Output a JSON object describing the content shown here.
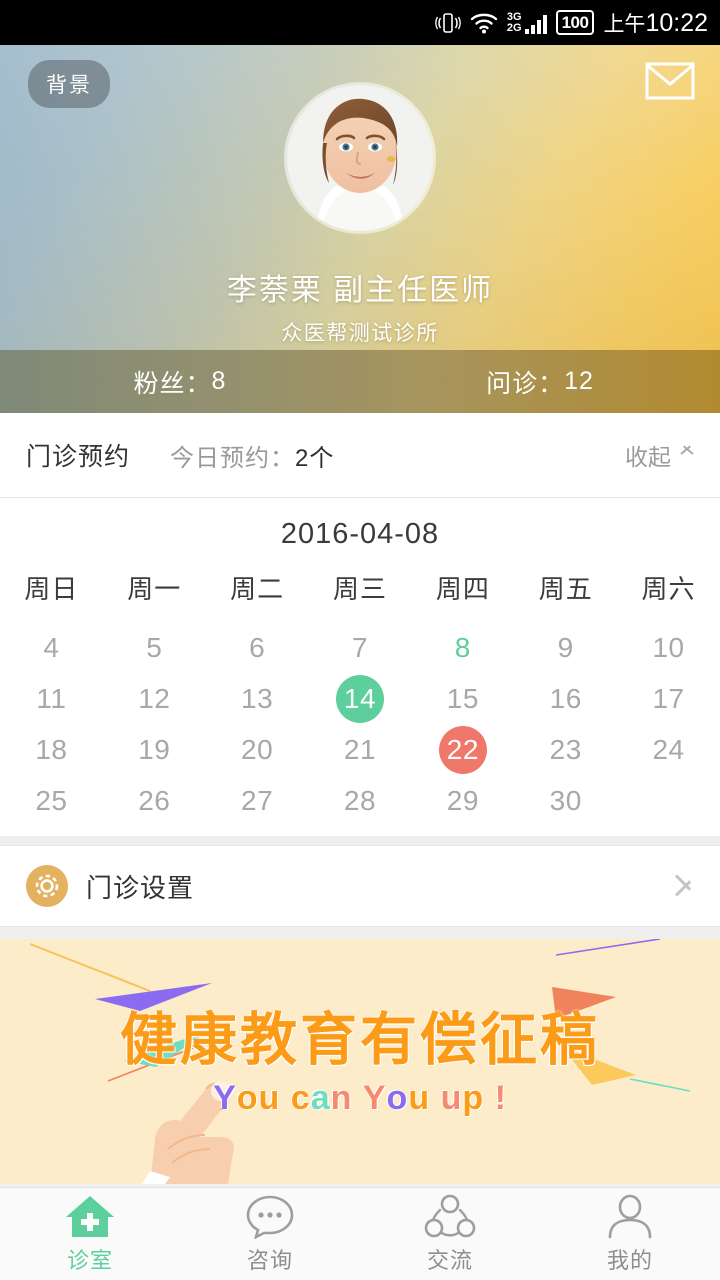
{
  "statusbar": {
    "vibrate_icon": "vibrate-icon",
    "wifi_icon": "wifi-icon",
    "signal_3g": "3G",
    "signal_2g": "2G",
    "battery": "100",
    "ampm": "上午",
    "time": "10:22"
  },
  "header": {
    "background_button": "背景",
    "mail_icon": "envelope-icon",
    "avatar_alt": "doctor-avatar",
    "doctor_name": "李萘栗 副主任医师",
    "clinic_name": "众医帮测试诊所",
    "gradient_from": "#9bb7c9",
    "gradient_to": "#f9cb57"
  },
  "stats": [
    {
      "label": "粉丝：",
      "value": "8"
    },
    {
      "label": "问诊：",
      "value": "12"
    }
  ],
  "appointments": {
    "title": "门诊预约",
    "today_label": "今日预约：",
    "today_count": "2个",
    "toggle_label": "收起"
  },
  "calendar": {
    "date": "2016-04-08",
    "weekdays": [
      "周日",
      "周一",
      "周二",
      "周三",
      "周四",
      "周五",
      "周六"
    ],
    "today_color": "#5dcf9d",
    "marked_green_color": "#5dcf9d",
    "marked_red_color": "#f0786a",
    "cells": [
      {
        "day": "4",
        "state": "normal"
      },
      {
        "day": "5",
        "state": "normal"
      },
      {
        "day": "6",
        "state": "normal"
      },
      {
        "day": "7",
        "state": "normal"
      },
      {
        "day": "8",
        "state": "today"
      },
      {
        "day": "9",
        "state": "normal"
      },
      {
        "day": "10",
        "state": "normal"
      },
      {
        "day": "11",
        "state": "normal"
      },
      {
        "day": "12",
        "state": "normal"
      },
      {
        "day": "13",
        "state": "normal"
      },
      {
        "day": "14",
        "state": "green"
      },
      {
        "day": "15",
        "state": "normal"
      },
      {
        "day": "16",
        "state": "normal"
      },
      {
        "day": "17",
        "state": "normal"
      },
      {
        "day": "18",
        "state": "normal"
      },
      {
        "day": "19",
        "state": "normal"
      },
      {
        "day": "20",
        "state": "normal"
      },
      {
        "day": "21",
        "state": "normal"
      },
      {
        "day": "22",
        "state": "red"
      },
      {
        "day": "23",
        "state": "normal"
      },
      {
        "day": "24",
        "state": "normal"
      },
      {
        "day": "25",
        "state": "normal"
      },
      {
        "day": "26",
        "state": "normal"
      },
      {
        "day": "27",
        "state": "normal"
      },
      {
        "day": "28",
        "state": "normal"
      },
      {
        "day": "29",
        "state": "normal"
      },
      {
        "day": "30",
        "state": "normal"
      },
      {
        "day": "",
        "state": "empty"
      }
    ]
  },
  "settings_row": {
    "icon": "gear-icon",
    "label": "门诊设置",
    "chevron": "chevron-right-icon",
    "icon_color": "#e3b261"
  },
  "banner": {
    "title": "健康教育有偿征稿",
    "title_color": "#fb9b18",
    "background": "#fcecc9",
    "subtitle_letters": [
      {
        "char": "Y",
        "color": "#8b6cf0"
      },
      {
        "char": "o",
        "color": "#fb9b18"
      },
      {
        "char": "u",
        "color": "#fb9b18"
      },
      {
        "char": " ",
        "color": "#fb9b18"
      },
      {
        "char": "c",
        "color": "#fb9b18"
      },
      {
        "char": "a",
        "color": "#6fdcc4"
      },
      {
        "char": "n",
        "color": "#f58a6e"
      },
      {
        "char": " ",
        "color": "#fb9b18"
      },
      {
        "char": "Y",
        "color": "#f58a6e"
      },
      {
        "char": "o",
        "color": "#8b6cf0"
      },
      {
        "char": "u",
        "color": "#fb9b18"
      },
      {
        "char": " ",
        "color": "#fb9b18"
      },
      {
        "char": "u",
        "color": "#f58a6e"
      },
      {
        "char": "p",
        "color": "#fb9b18"
      },
      {
        "char": " ",
        "color": "#fb9b18"
      },
      {
        "char": "!",
        "color": "#f58a6e"
      }
    ],
    "subtitle_text": "You can You up !"
  },
  "tabbar": {
    "active_color": "#5dcf9d",
    "items": [
      {
        "label": "诊室",
        "icon": "clinic-house-icon",
        "active": true
      },
      {
        "label": "咨询",
        "icon": "chat-bubble-icon",
        "active": false
      },
      {
        "label": "交流",
        "icon": "network-icon",
        "active": false
      },
      {
        "label": "我的",
        "icon": "person-icon",
        "active": false
      }
    ]
  }
}
